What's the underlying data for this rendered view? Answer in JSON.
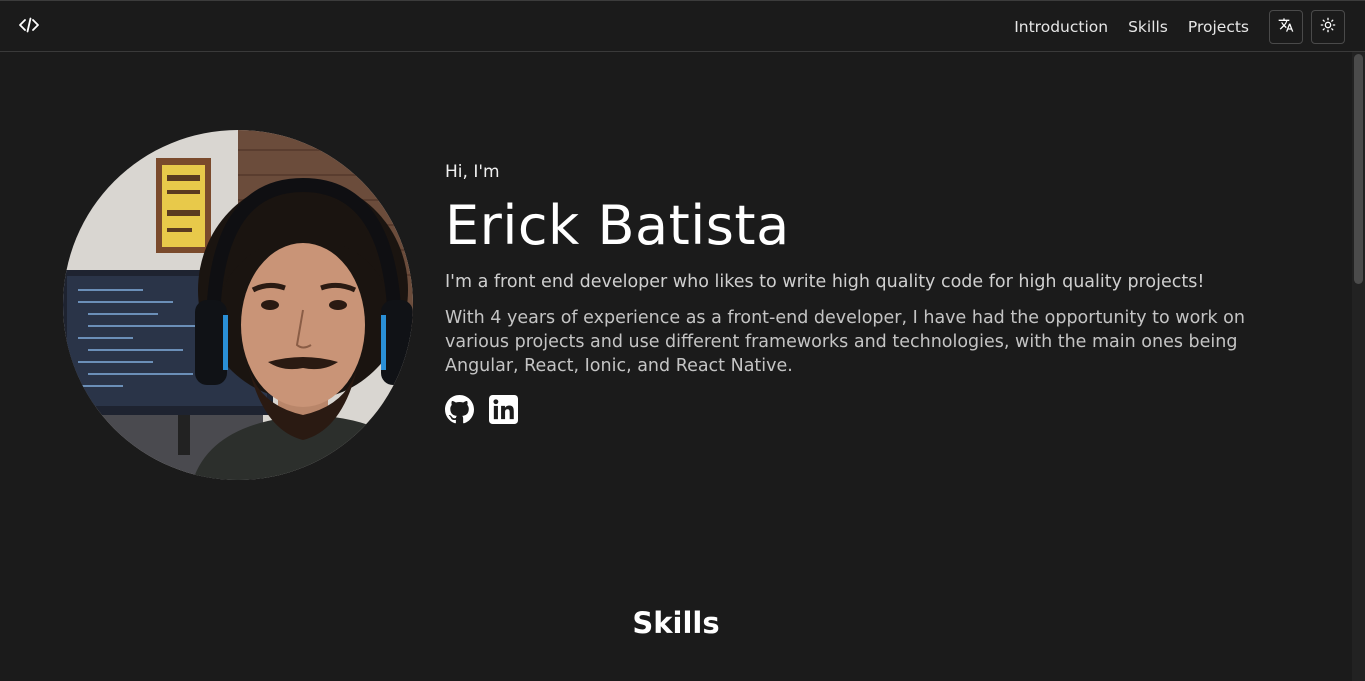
{
  "header": {
    "logo_icon": "code-brackets-icon",
    "nav": {
      "introduction": "Introduction",
      "skills": "Skills",
      "projects": "Projects"
    },
    "translate_icon": "translate-icon",
    "theme_icon": "sun-icon"
  },
  "hero": {
    "greeting": "Hi, I'm",
    "name": "Erick Batista",
    "tagline": "I'm a front end developer who likes to write high quality code for high quality projects!",
    "about": "With 4 years of experience as a front-end developer, I have had the opportunity to work on various projects and use different frameworks and technologies, with the main ones being Angular, React, Ionic, and React Native.",
    "socials": [
      {
        "icon": "github-icon"
      },
      {
        "icon": "linkedin-icon"
      }
    ]
  },
  "skills": {
    "title": "Skills"
  },
  "colors": {
    "background": "#1b1b1b",
    "text": "#ffffff",
    "muted_text": "#c4c4c4",
    "border": "#4a4a4a"
  }
}
